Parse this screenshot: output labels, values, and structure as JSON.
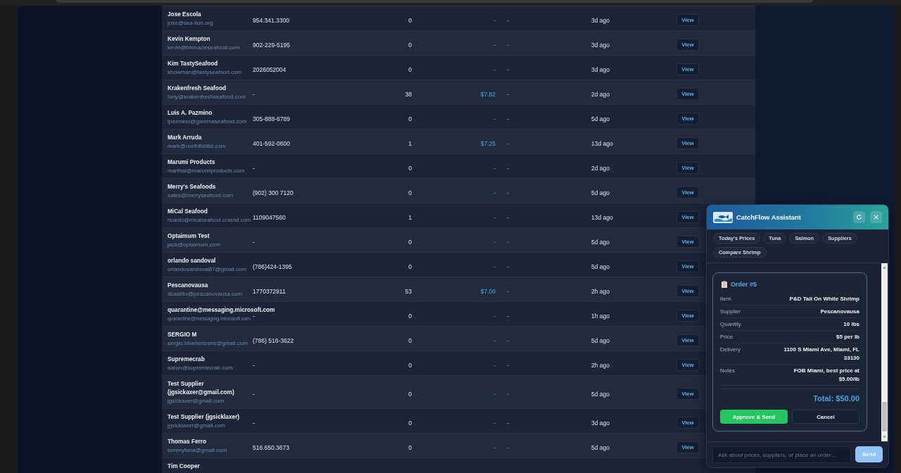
{
  "table": {
    "rows": [
      {
        "name": "Jose Escola",
        "email": "jose@sea-lion.org",
        "phone": "954.341.3300",
        "column_3": "0",
        "column_4": "-",
        "column_5": "-",
        "column_6": "3d ago",
        "action": "View"
      },
      {
        "name": "Kevin Kempton",
        "email": "kevin@binnacleseafood.com",
        "phone": "902-229-5195",
        "column_3": "0",
        "column_4": "-",
        "column_5": "-",
        "column_6": "3d ago",
        "action": "View"
      },
      {
        "name": "Kim TastySeafood",
        "email": "kbowman@tastyseafood.com",
        "phone": "2026052004",
        "column_3": "0",
        "column_4": "-",
        "column_5": "-",
        "column_6": "3d ago",
        "action": "View"
      },
      {
        "name": "Krakenfresh Seafood",
        "email": "tony@krakenfreshseafood.com",
        "phone": "-",
        "column_3": "38",
        "column_4": "$7.82",
        "column_5": "-",
        "column_6": "2d ago",
        "action": "View"
      },
      {
        "name": "Luis A. Pazmino",
        "email": "lpazmino@gammaseafood.com",
        "phone": "305-888-6789",
        "column_3": "0",
        "column_4": "-",
        "column_5": "-",
        "column_6": "5d ago",
        "action": "View"
      },
      {
        "name": "Mark Arruda",
        "email": "mark@northfishltd.com",
        "phone": "401-592-0600",
        "column_3": "1",
        "column_4": "$7.25",
        "column_5": "-",
        "column_6": "13d ago",
        "action": "View"
      },
      {
        "name": "Marumi Products",
        "email": "marthal@marumiproducts.com",
        "phone": "-",
        "column_3": "0",
        "column_4": "-",
        "column_5": "-",
        "column_6": "2d ago",
        "action": "View"
      },
      {
        "name": "Merry's Seafoods",
        "email": "sales@merryseafood.com",
        "phone": "(902) 300 7120",
        "column_3": "0",
        "column_4": "-",
        "column_5": "-",
        "column_6": "5d ago",
        "action": "View"
      },
      {
        "name": "MiCal Seafood",
        "email": "ricardo@micalseafood.ccsend.com",
        "phone": "1109047560",
        "column_3": "1",
        "column_4": "-",
        "column_5": "-",
        "column_6": "13d ago",
        "action": "View"
      },
      {
        "name": "Optaimum Test",
        "email": "jack@optaimum.com",
        "phone": "-",
        "column_3": "0",
        "column_4": "-",
        "column_5": "-",
        "column_6": "5d ago",
        "action": "View"
      },
      {
        "name": "orlando sandoval",
        "email": "orlandosandoval87@gmail.com",
        "phone": "(786)424-1395",
        "column_3": "0",
        "column_4": "-",
        "column_5": "-",
        "column_6": "5d ago",
        "action": "View"
      },
      {
        "name": "Pescanovausa",
        "email": "dcastillo@pescanovausa.com",
        "phone": "1770372911",
        "column_3": "53",
        "column_4": "$7.00",
        "column_5": "-",
        "column_6": "2h ago",
        "action": "View"
      },
      {
        "name": "quarantine@messaging.microsoft.com",
        "email": "quarantine@messaging.microsoft.com",
        "phone": "-",
        "column_3": "0",
        "column_4": "-",
        "column_5": "-",
        "column_6": "1h ago",
        "action": "View"
      },
      {
        "name": "SERGIO M",
        "email": "sergio.bluehorizons@gmail.com",
        "phone": "(786) 516-3622",
        "column_3": "0",
        "column_4": "-",
        "column_5": "-",
        "column_6": "5d ago",
        "action": "View"
      },
      {
        "name": "Supremecrab",
        "email": "aaron@supremecrab.com",
        "phone": "-",
        "column_3": "0",
        "column_4": "-",
        "column_5": "-",
        "column_6": "2h ago",
        "action": "View"
      },
      {
        "name": "Test Supplier (jgsickaxer@gmail.com)",
        "email": "jgsickaxer@gmail.com",
        "phone": "-",
        "column_3": "0",
        "column_4": "-",
        "column_5": "-",
        "column_6": "5d ago",
        "action": "View"
      },
      {
        "name": "Test Supplier (jgsicklaxer)",
        "email": "jgsicklaxer@gmail.com",
        "phone": "-",
        "column_3": "0",
        "column_4": "-",
        "column_5": "-",
        "column_6": "3d ago",
        "action": "View"
      },
      {
        "name": "Thomas Ferro",
        "email": "tommytuna@gmail.com",
        "phone": "516.650.3673",
        "column_3": "0",
        "column_4": "-",
        "column_5": "-",
        "column_6": "5d ago",
        "action": "View"
      },
      {
        "name": "Tim Cooper"
      }
    ]
  },
  "assistant": {
    "title": "CatchFlow Assistant",
    "chips": [
      "Today's Prices",
      "Tuna",
      "Salmon",
      "Suppliers",
      "Compare Shrimp"
    ],
    "order": {
      "title": "Order #5",
      "fields": [
        {
          "label": "Item",
          "value": "P&D Tail On White Shrimp"
        },
        {
          "label": "Supplier",
          "value": "Pescanovausa"
        },
        {
          "label": "Quantity",
          "value": "10 lbs"
        },
        {
          "label": "Price",
          "value": "$5 per lb"
        },
        {
          "label": "Delivery",
          "value": "1100 S Miami Ave, Miami, FL 33130"
        },
        {
          "label": "Notes",
          "value": "FOB Miami, best price at $5.00/lb"
        }
      ],
      "total": "Total: $50.00",
      "buttons": [
        {
          "label": "Approve & Send",
          "kind": "primary"
        },
        {
          "label": "Cancel",
          "kind": "secondary"
        }
      ]
    },
    "input": {
      "placeholder": "Ask about prices, suppliers, or place an order..."
    },
    "send_button": "Send"
  }
}
